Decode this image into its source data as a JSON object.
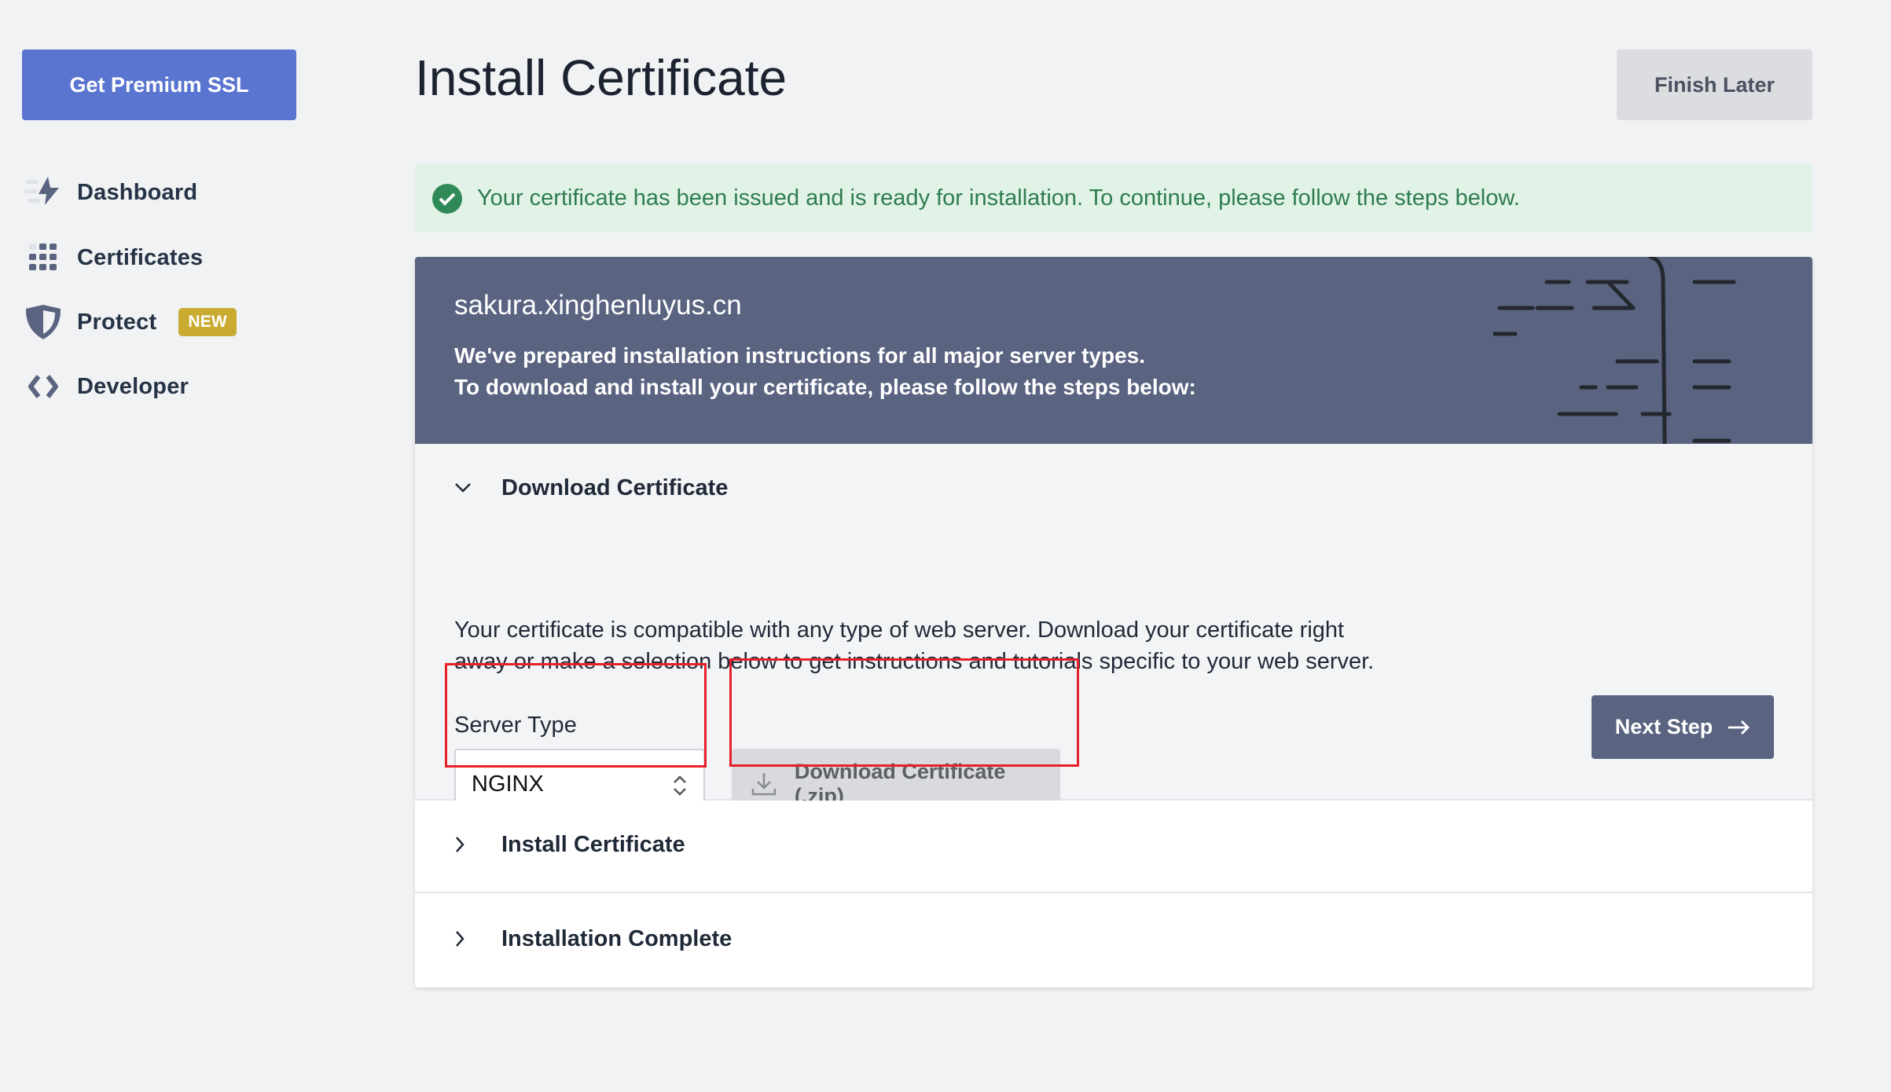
{
  "sidebar": {
    "premium_button": "Get Premium SSL",
    "items": [
      {
        "label": "Dashboard",
        "icon": "lightning-icon"
      },
      {
        "label": "Certificates",
        "icon": "grid-icon"
      },
      {
        "label": "Protect",
        "icon": "shield-icon",
        "badge": "NEW"
      },
      {
        "label": "Developer",
        "icon": "code-icon"
      }
    ]
  },
  "header": {
    "title": "Install Certificate",
    "finish_later": "Finish Later"
  },
  "alert": {
    "text": "Your certificate has been issued and is ready for installation. To continue, please follow the steps below."
  },
  "card": {
    "domain": "sakura.xinghenluyus.cn",
    "line1": "We've prepared installation instructions for all major server types.",
    "line2": "To download and install your certificate, please follow the steps below:",
    "steps": [
      {
        "title": "Download Certificate",
        "expanded": true
      },
      {
        "title": "Install Certificate",
        "expanded": false
      },
      {
        "title": "Installation Complete",
        "expanded": false
      }
    ],
    "description_line1": "Your certificate is compatible with any type of web server. Download your certificate right",
    "description_line2": "away or make a selection below to get instructions and tutorials specific to your web server.",
    "server_type_label": "Server Type",
    "server_type_value": "NGINX",
    "download_button": "Download Certificate (.zip)",
    "next_button": "Next Step"
  },
  "colors": {
    "accent": "#5a75cf",
    "header": "#5a6380",
    "badge": "#c9ab32",
    "success": "#2f8a57",
    "highlight": "#e8202a"
  }
}
